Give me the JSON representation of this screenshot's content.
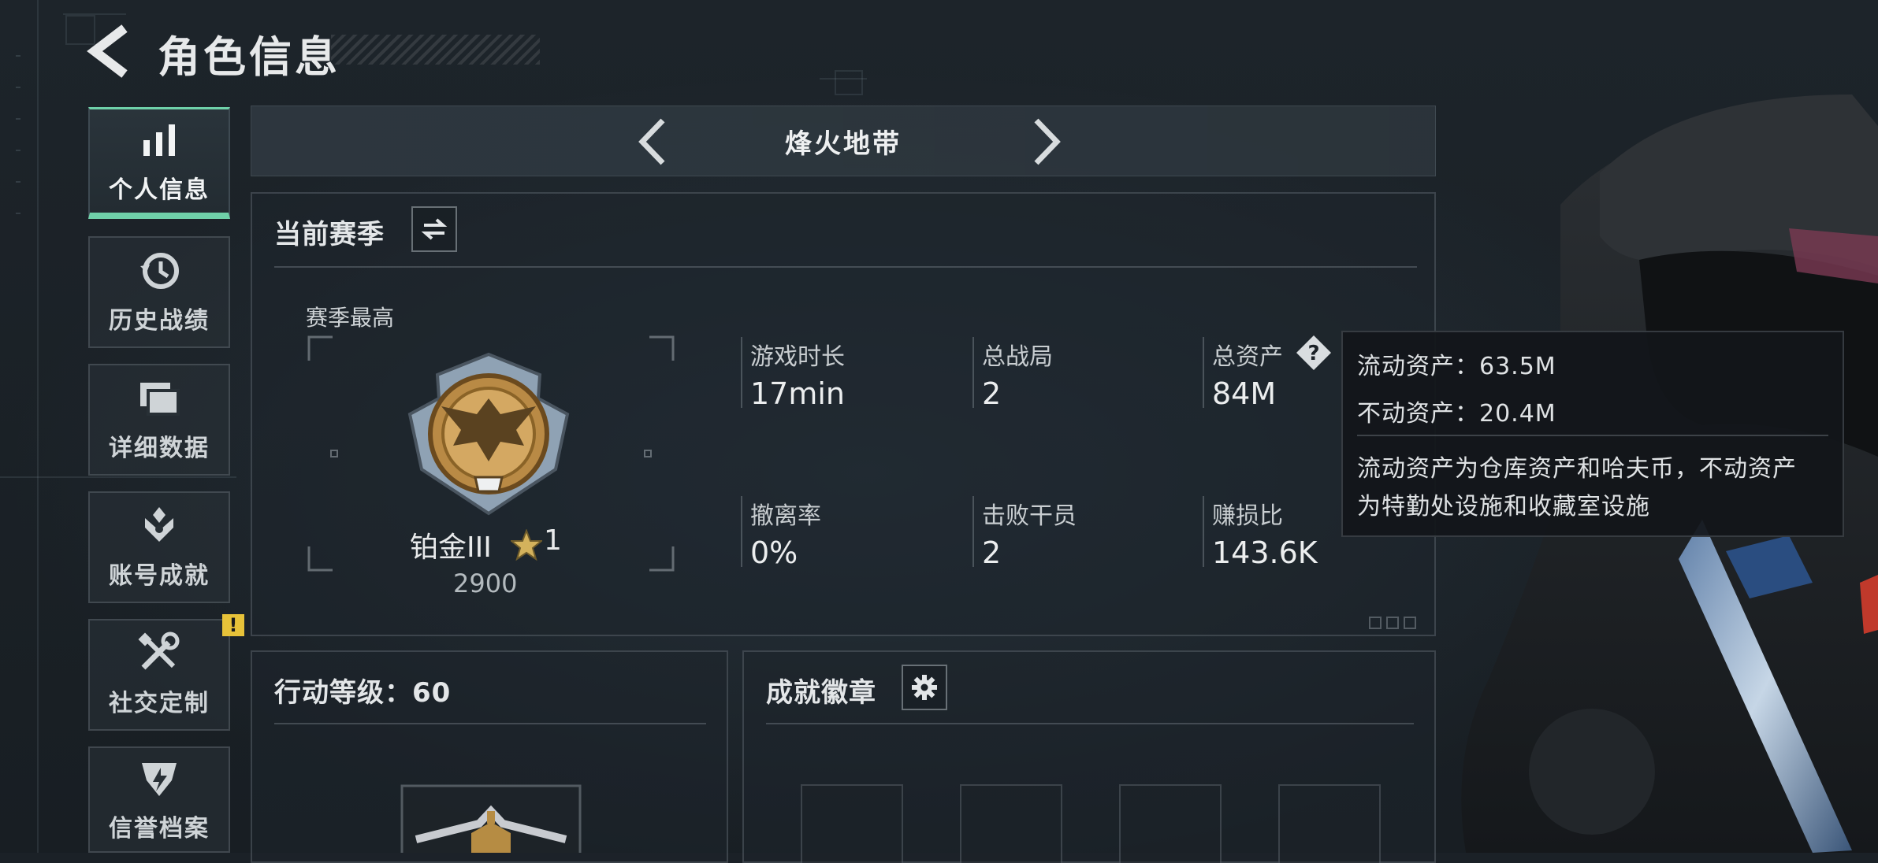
{
  "header": {
    "title": "角色信息"
  },
  "sidebar": {
    "items": [
      {
        "label": "个人信息",
        "icon": "bar-chart-icon",
        "active": true
      },
      {
        "label": "历史战绩",
        "icon": "history-clock-icon",
        "active": false
      },
      {
        "label": "详细数据",
        "icon": "stacked-cards-icon",
        "active": false
      },
      {
        "label": "账号成就",
        "icon": "achievement-emblem-icon",
        "active": false
      },
      {
        "label": "社交定制",
        "icon": "wrench-screwdriver-icon",
        "active": false,
        "alert": "!"
      },
      {
        "label": "信誉档案",
        "icon": "credit-shield-icon",
        "active": false
      }
    ]
  },
  "mode_selector": {
    "current": "烽火地带",
    "prev_icon": "chevron-left-icon",
    "next_icon": "chevron-right-icon"
  },
  "season_panel": {
    "title": "当前赛季",
    "switch_icon": "swap-arrows-icon",
    "best_label": "赛季最高",
    "rank": {
      "name": "铂金III",
      "stars": "1",
      "score": "2900",
      "badge_icon": "platinum-eagle-rank-icon"
    },
    "stats": [
      {
        "label": "游戏时长",
        "value": "17min"
      },
      {
        "label": "总战局",
        "value": "2"
      },
      {
        "label": "总资产",
        "value": "84M"
      },
      {
        "label": "撤离率",
        "value": "0%"
      },
      {
        "label": "击败干员",
        "value": "2"
      },
      {
        "label": "赚损比",
        "value": "143.6K"
      }
    ]
  },
  "asset_tooltip": {
    "liquid": "流动资产：63.5M",
    "fixed": "不动资产：20.4M",
    "description_line1": "流动资产为仓库资产和哈夫币，不动资产",
    "description_line2": "为特勤处设施和收藏室设施"
  },
  "action_level_panel": {
    "title": "行动等级：60"
  },
  "badges_panel": {
    "title": "成就徽章",
    "settings_icon": "gear-icon"
  },
  "colors": {
    "accent": "#6fd1a9",
    "alert": "#e7c239",
    "background": "#1b2127"
  }
}
